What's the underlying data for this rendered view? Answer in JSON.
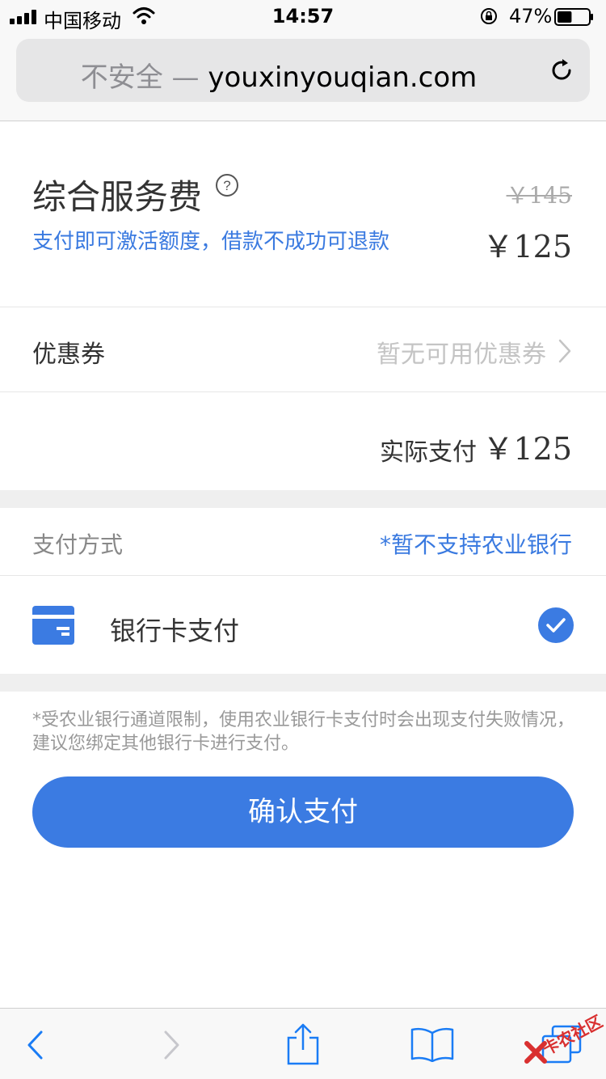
{
  "status_bar": {
    "carrier": "中国移动",
    "time": "14:57",
    "battery_percent": "47%",
    "battery_level": 0.47
  },
  "browser": {
    "url_insecure": "不安全 —",
    "url_domain": "youxinyouqian.com"
  },
  "fee": {
    "title": "综合服务费",
    "description": "支付即可激活额度，借款不成功可退款",
    "original_price": "￥145",
    "current_price": "￥125"
  },
  "coupon": {
    "label": "优惠券",
    "value": "暂无可用优惠券"
  },
  "actual_payment": {
    "label": "实际支付",
    "value": "￥125"
  },
  "payment_method": {
    "label": "支付方式",
    "note": "*暂不支持农业银行",
    "option_label": "银行卡支付",
    "option_selected": true
  },
  "notice": "*受农业银行通道限制，使用农业银行卡支付时会出现支付失败情况，建议您绑定其他银行卡进行支付。",
  "confirm_button": "确认支付",
  "watermark": "卡农社区",
  "colors": {
    "accent": "#3b7be2",
    "link": "#3a7ae0",
    "muted": "#999999",
    "ios_blue": "#1a7cf5"
  },
  "icons": [
    "signal-icon",
    "wifi-icon",
    "orientation-lock-icon",
    "battery-icon",
    "reload-icon",
    "help-icon",
    "chevron-right-icon",
    "card-icon",
    "check-icon",
    "back-icon",
    "forward-icon",
    "share-icon",
    "bookmarks-icon",
    "tabs-icon"
  ]
}
